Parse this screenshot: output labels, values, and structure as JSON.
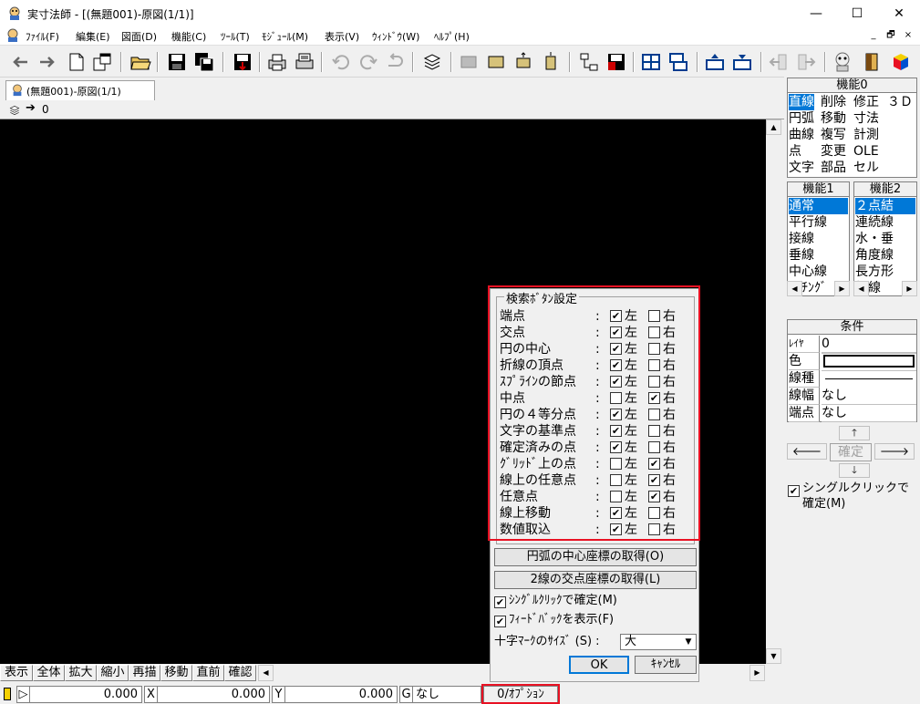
{
  "window": {
    "title": "実寸法師 - [(無題001)-原図(1/1)]",
    "minimize": "—",
    "maximize": "☐",
    "close": "✕"
  },
  "menu": [
    "ﾌｧｲﾙ(F)",
    "編集(E)",
    "図面(D)",
    "機能(C)",
    "ﾂｰﾙ(T)",
    "ﾓｼﾞｭｰﾙ(M)",
    "表示(V)",
    "ｳｨﾝﾄﾞｳ(W)",
    "ﾍﾙﾌﾟ(H)"
  ],
  "mdi_controls": [
    "_",
    "🗗",
    "×"
  ],
  "document_tab": "(無題001)-原図(1/1)",
  "layer": {
    "value": "0"
  },
  "bottom_buttons": [
    "表示",
    "全体",
    "拡大",
    "縮小",
    "再描",
    "移動",
    "直前",
    "確認"
  ],
  "status": {
    "x_label": "X",
    "x_value": "0.000",
    "y_label": "Y",
    "y_value": "0.000",
    "d_label": "▷",
    "d_value": "0.000",
    "g_label": "G",
    "g_value": "なし",
    "option": "0/ｵﾌﾟｼｮﾝ"
  },
  "func0": {
    "title": "機能0",
    "grid": [
      [
        "直線",
        "削除",
        "修正",
        "３Ｄ"
      ],
      [
        "円弧",
        "移動",
        "寸法",
        ""
      ],
      [
        "曲線",
        "複写",
        "計測",
        ""
      ],
      [
        "点",
        "変更",
        "OLE",
        ""
      ],
      [
        "文字",
        "部品",
        "セル",
        ""
      ]
    ],
    "selected": "直線"
  },
  "func1": {
    "title": "機能1",
    "items": [
      "通常",
      "平行線",
      "接線",
      "垂線",
      "中心線",
      "ﾊｯﾁﾝｸﾞ"
    ],
    "selected": "通常"
  },
  "func2": {
    "title": "機能2",
    "items": [
      "２点結",
      "連続線",
      "水・垂",
      "角度線",
      "長方形",
      "折線"
    ],
    "selected": "２点結"
  },
  "condition": {
    "title": "条件",
    "rows": [
      {
        "label": "ﾚｲﾔ",
        "value": "0"
      },
      {
        "label": "色",
        "value": ""
      },
      {
        "label": "線種",
        "value": ""
      },
      {
        "label": "線幅",
        "value": "なし"
      },
      {
        "label": "端点",
        "value": "なし"
      }
    ],
    "confirm": "確定",
    "single_click": "シングルクリックで\n確定(M)"
  },
  "dialog": {
    "group_title": "検索ﾎﾞﾀﾝ設定",
    "left_label": "左",
    "right_label": "右",
    "rows": [
      {
        "label": "端点",
        "left": true,
        "right": false
      },
      {
        "label": "交点",
        "left": true,
        "right": false
      },
      {
        "label": "円の中心",
        "left": true,
        "right": false
      },
      {
        "label": "折線の頂点",
        "left": true,
        "right": false
      },
      {
        "label": "ｽﾌﾟﾗｲﾝの節点",
        "left": true,
        "right": false
      },
      {
        "label": "中点",
        "left": false,
        "right": true
      },
      {
        "label": "円の４等分点",
        "left": true,
        "right": false
      },
      {
        "label": "文字の基準点",
        "left": true,
        "right": false
      },
      {
        "label": "確定済みの点",
        "left": true,
        "right": false
      },
      {
        "label": "ｸﾞﾘｯﾄﾞ上の点",
        "left": false,
        "right": true
      },
      {
        "label": "線上の任意点",
        "left": false,
        "right": true
      },
      {
        "label": "任意点",
        "left": false,
        "right": true
      },
      {
        "label": "線上移動",
        "left": true,
        "right": false
      },
      {
        "label": "数値取込",
        "left": true,
        "right": false
      }
    ],
    "btn_arc_center": "円弧の中心座標の取得(O)",
    "btn_intersection": "2線の交点座標の取得(L)",
    "chk_single_click": "ｼﾝｸﾞﾙｸﾘｯｸで確定(M)",
    "chk_feedback": "ﾌｨｰﾄﾞﾊﾞｯｸを表示(F)",
    "cross_size_label": "十字ﾏｰｸのｻｲｽﾞ (S) :",
    "cross_size_value": "大",
    "ok": "OK",
    "cancel": "ｷｬﾝｾﾙ"
  },
  "colors": {
    "highlight": "#0078d7",
    "red_frame": "#e81123",
    "canvas": "#000000"
  }
}
